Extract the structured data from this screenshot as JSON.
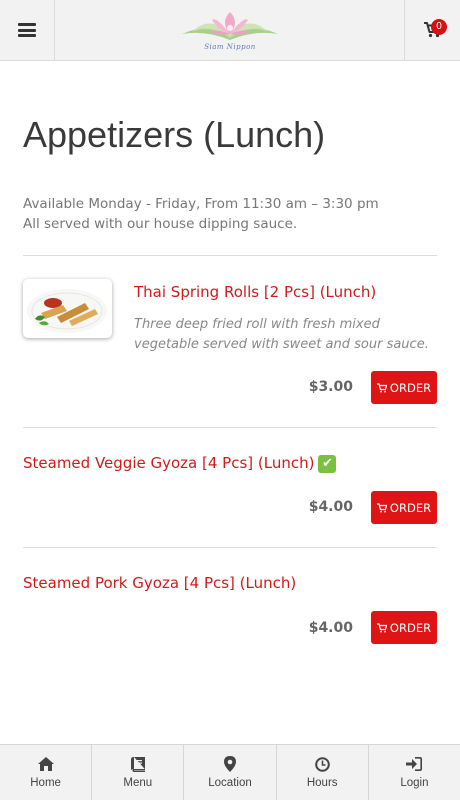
{
  "header": {
    "logo_text": "Siam Nippon",
    "cart_count": "0",
    "menu_icon": "hamburger-icon",
    "cart_icon": "cart-icon"
  },
  "page": {
    "title": "Appetizers (Lunch)",
    "description_line1": "Available Monday - Friday, From 11:30 am – 3:30 pm",
    "description_line2": "All served with our house dipping sauce."
  },
  "items": [
    {
      "name": "Thai Spring Rolls [2 Pcs] (Lunch)",
      "description": "Three deep fried roll with fresh mixed vegetable served with sweet and sour sauce.",
      "price": "$3.00",
      "order_label": "ORDER"
    },
    {
      "name": "Steamed Veggie Gyoza [4 Pcs] (Lunch)",
      "badge": "✔",
      "price": "$4.00",
      "order_label": "ORDER"
    },
    {
      "name": "Steamed Pork Gyoza [4 Pcs] (Lunch)",
      "price": "$4.00",
      "order_label": "ORDER"
    }
  ],
  "bottom_nav": [
    {
      "label": "Home",
      "icon": "home-icon"
    },
    {
      "label": "Menu",
      "icon": "book-icon"
    },
    {
      "label": "Location",
      "icon": "map-marker-icon"
    },
    {
      "label": "Hours",
      "icon": "clock-icon"
    },
    {
      "label": "Login",
      "icon": "sign-in-icon"
    }
  ],
  "colors": {
    "accent": "#e01414",
    "title_red": "#d11a1a",
    "header_bg": "#f2f2f2",
    "veg_green": "#7ac142"
  }
}
